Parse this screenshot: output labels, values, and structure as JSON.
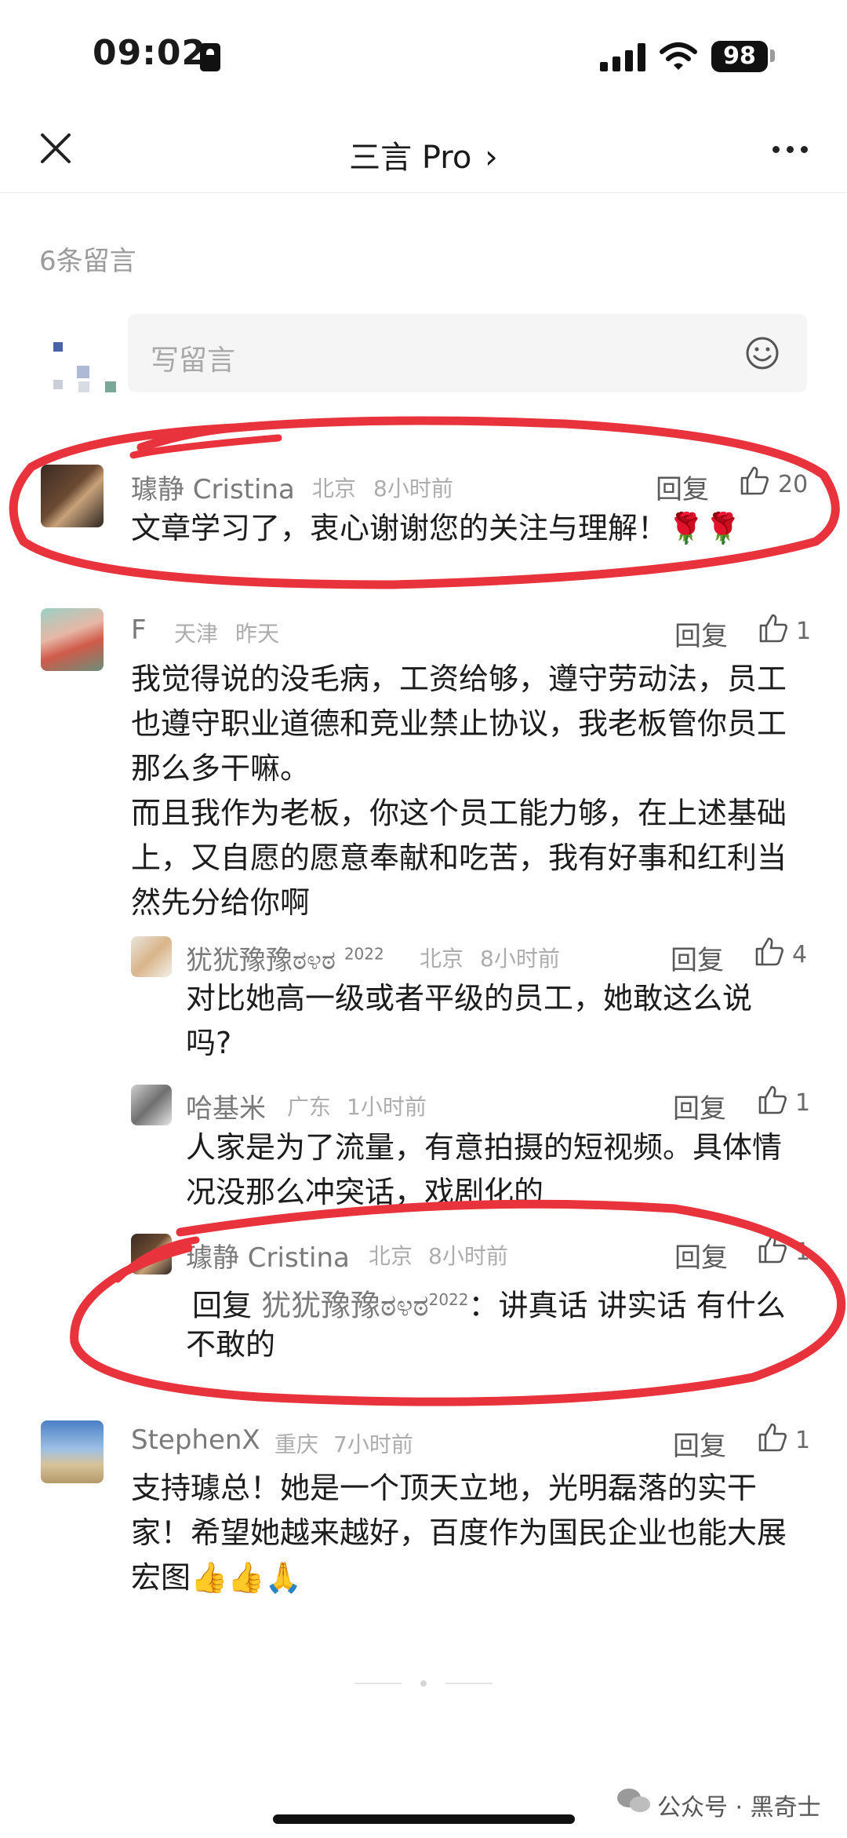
{
  "status_bar": {
    "time": "09:02",
    "battery": "98"
  },
  "nav": {
    "title": "三言 Pro",
    "title_chevron": "›",
    "close_icon": "close-icon",
    "more_icon": "more-icon"
  },
  "comments_header": {
    "count_label": "6条留言"
  },
  "compose": {
    "placeholder": "写留言",
    "icon": "emoji-icon"
  },
  "comments": [
    {
      "name": "璩静 Cristina",
      "location": "北京",
      "time": "8小时前",
      "reply_label": "回复",
      "likes": "20",
      "lines": [
        "文章学习了，衷心谢谢您的关注与理解！🌹🌹"
      ]
    },
    {
      "name": "F",
      "location": "天津",
      "time": "昨天",
      "reply_label": "回复",
      "likes": "1",
      "lines": [
        "我觉得说的没毛病，工资给够，遵守劳动法，员工",
        "也遵守职业道德和竞业禁止协议，我老板管你员工",
        "那么多干嘛。",
        "而且我作为老板，你这个员工能力够，在上述基础",
        "上，又自愿的愿意奉献和吃苦，我有好事和红利当",
        "然先分给你啊"
      ],
      "replies": [
        {
          "name": "犹犹豫豫ಠ೪ಠ",
          "badge": "2022",
          "location": "北京",
          "time": "8小时前",
          "reply_label": "回复",
          "likes": "4",
          "lines": [
            "对比她高一级或者平级的员工，她敢这么说",
            "吗?"
          ]
        },
        {
          "name": "哈基米",
          "location": "广东",
          "time": "1小时前",
          "reply_label": "回复",
          "likes": "1",
          "lines": [
            "人家是为了流量，有意拍摄的短视频。具体情",
            "况没那么冲突话，戏剧化的"
          ]
        },
        {
          "name": "璩静 Cristina",
          "location": "北京",
          "time": "8小时前",
          "reply_label": "回复",
          "likes": "1",
          "reply_to_label": "回复",
          "reply_to_name": "犹犹豫豫ಠ೪ಠ",
          "reply_to_badge": "2022",
          "lines": [
            "：讲真话 讲实话 有什么",
            "不敢的"
          ]
        }
      ]
    },
    {
      "name": "StephenX",
      "location": "重庆",
      "time": "7小时前",
      "reply_label": "回复",
      "likes": "1",
      "lines": [
        "支持璩总！她是一个顶天立地，光明磊落的实干",
        "家！希望她越来越好，百度作为国民企业也能大展",
        "宏图👍👍🙏"
      ]
    }
  ],
  "footer": {
    "source": "公众号 · 黑奇士"
  },
  "colors": {
    "annotation_red": "#e8323c",
    "text": "#1c1c1c",
    "meta": "#adadad"
  }
}
